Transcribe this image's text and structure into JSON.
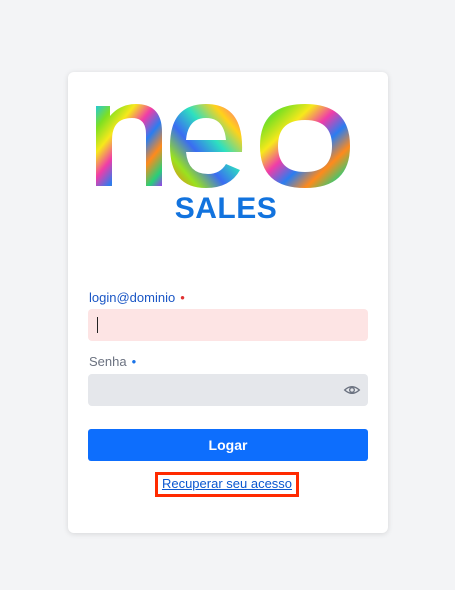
{
  "logo": {
    "wordmark": "neo",
    "subtitle": "SALES",
    "accent_color": "#1273de"
  },
  "form": {
    "login": {
      "label": "login@dominio",
      "required_mark": "•",
      "value": ""
    },
    "password": {
      "label": "Senha",
      "required_mark": "•",
      "value": "",
      "toggle_icon": "eye-icon"
    },
    "submit_label": "Logar",
    "recover_label": "Recuperar seu acesso"
  },
  "colors": {
    "primary": "#0d6efd",
    "error_bg": "#fde4e4",
    "highlight_border": "#ff2a00"
  }
}
